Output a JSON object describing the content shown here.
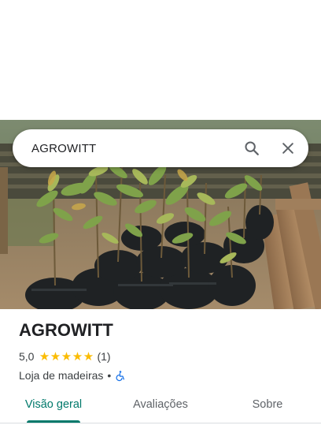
{
  "search": {
    "query": "AGROWITT",
    "search_icon": "search-icon",
    "close_icon": "close-icon"
  },
  "place": {
    "name": "AGROWITT",
    "rating": "5,0",
    "rating_value": 5,
    "stars": [
      "★",
      "★",
      "★",
      "★",
      "★"
    ],
    "review_count": "(1)",
    "category": "Loja de madeiras",
    "separator": "•",
    "accessibility_icon": "wheelchair-icon"
  },
  "hero_photo": {
    "subject": "seedlings-in-bags"
  },
  "tabs": [
    {
      "label": "Visão geral",
      "active": true
    },
    {
      "label": "Avaliações",
      "active": false
    },
    {
      "label": "Sobre",
      "active": false
    }
  ],
  "colors": {
    "accent": "#00796b",
    "star": "#fbbc04",
    "text_primary": "#202124",
    "text_secondary": "#3c4043"
  }
}
